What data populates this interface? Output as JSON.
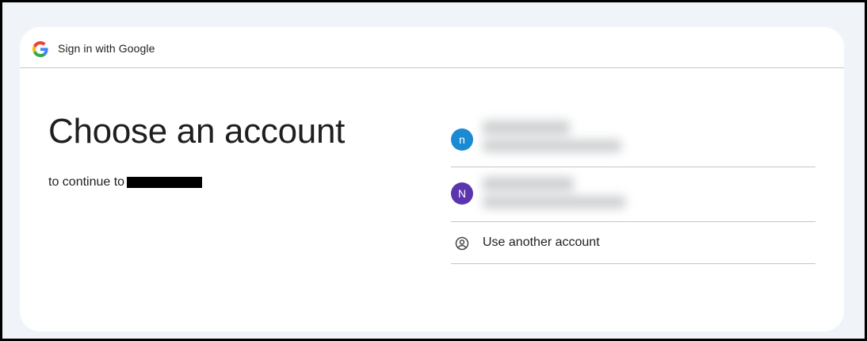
{
  "header": {
    "title": "Sign in with Google",
    "logo_icon": "google-g-icon"
  },
  "main": {
    "title": "Choose an account",
    "subtitle": "to continue to"
  },
  "accounts": [
    {
      "initial": "n",
      "avatar_color": "#1a8ad2"
    },
    {
      "initial": "N",
      "avatar_color": "#5b34b0"
    }
  ],
  "other_account": {
    "label": "Use another account",
    "icon": "account-circle-icon"
  }
}
